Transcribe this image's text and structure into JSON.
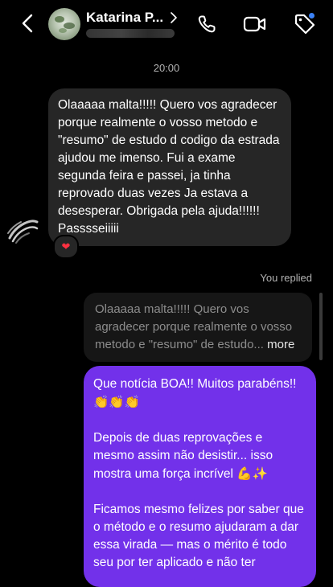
{
  "header": {
    "contact_name": "Katarina P...",
    "icons": [
      "back-icon",
      "call-icon",
      "video-icon",
      "tag-icon"
    ]
  },
  "timestamp": "20:00",
  "incoming": {
    "text": "Olaaaaa malta!!!!! Quero vos agradecer  porque realmente o vosso metodo e \"resumo\" de estudo d codigo da estrada ajudou me imenso. Fui a exame segunda feira e passei, ja tinha reprovado duas vezes Ja estava a desesperar. Obrigada pela ajuda!!!!!! Passsseiiiii",
    "reaction": "❤"
  },
  "reply_label": "You replied",
  "quoted": {
    "text": "Olaaaaa malta!!!!! Quero vos agradecer  porque realmente o vosso metodo e \"resumo\" de estudo...",
    "more": "more"
  },
  "outgoing": {
    "p1": "Que notícia BOA!! Muitos parabéns!!",
    "p1_emoji": "👏👏👏",
    "p2": "Depois de duas reprovações e mesmo assim não desistir... isso mostra uma força incrível",
    "p2_emoji_1": "💪",
    "p2_emoji_2": "✨",
    "p3": "Ficamos mesmo felizes por saber que o método e o resumo ajudaram a dar essa virada — mas o mérito é todo seu por ter aplicado e não ter"
  },
  "colors": {
    "background": "#000000",
    "incoming_bubble": "#262626",
    "outgoing_bubble": "#7231ea",
    "quoted_bubble": "#161616",
    "reaction_heart": "#ff3040"
  }
}
